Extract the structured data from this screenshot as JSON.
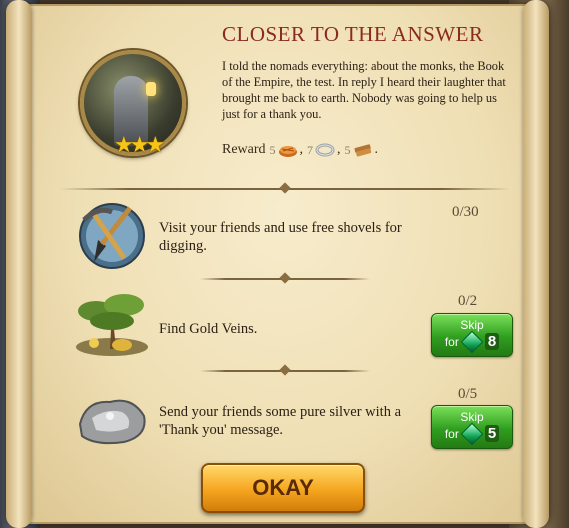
{
  "dialog": {
    "title": "CLOSER TO THE ANSWER",
    "story": "I told the nomads everything: about the monks, the Book of the Empire, the test. In reply I heard their laughter that brought me back to earth. Nobody was going to help us just for a thank you.",
    "stars": 3,
    "reward_label": "Reward",
    "rewards": [
      {
        "amount": "5",
        "icon": "pie-icon",
        "sep": ","
      },
      {
        "amount": "7",
        "icon": "silver-ring-icon",
        "sep": ","
      },
      {
        "amount": "5",
        "icon": "wood-planks-icon",
        "sep": "."
      }
    ]
  },
  "quests": [
    {
      "icon": "shovel-pickaxe-icon",
      "text": "Visit your friends and use free shovels for digging.",
      "progress": "0/30",
      "skip": null
    },
    {
      "icon": "gold-vein-tree-icon",
      "text": "Find Gold Veins.",
      "progress": "0/2",
      "skip": {
        "label": "Skip",
        "for": "for",
        "cost": "8",
        "currency_icon": "emerald-icon"
      }
    },
    {
      "icon": "silver-ore-icon",
      "text": "Send your friends some pure silver with a 'Thank you' message.",
      "progress": "0/5",
      "skip": {
        "label": "Skip",
        "for": "for",
        "cost": "5",
        "currency_icon": "emerald-icon"
      }
    }
  ],
  "ok_label": "OKAY"
}
